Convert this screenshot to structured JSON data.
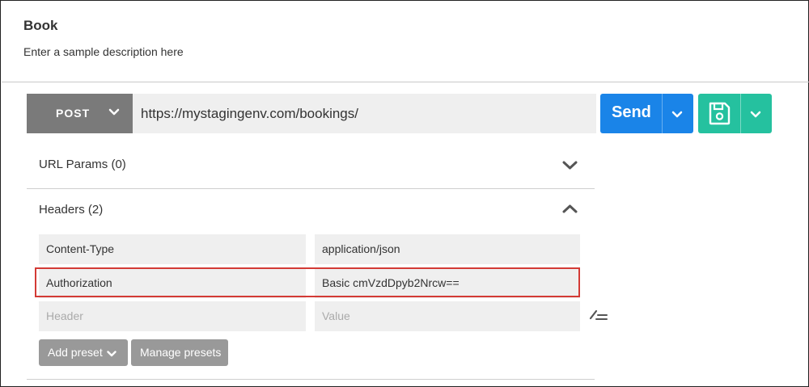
{
  "request": {
    "title": "Book",
    "description": "Enter a sample description here"
  },
  "toolbar": {
    "method": "POST",
    "url": "https://mystagingenv.com/bookings/",
    "send_label": "Send"
  },
  "url_params": {
    "label": "URL Params (0)",
    "expanded": false
  },
  "headers": {
    "label": "Headers (2)",
    "expanded": true,
    "rows": [
      {
        "key": "Content-Type",
        "value": "application/json",
        "highlighted": false
      },
      {
        "key": "Authorization",
        "value": "Basic cmVzdDpyb2Nrcw==",
        "highlighted": true
      }
    ],
    "new_row": {
      "key_placeholder": "Header",
      "value_placeholder": "Value"
    },
    "add_preset_label": "Add preset",
    "manage_presets_label": "Manage presets"
  },
  "colors": {
    "method_bg": "#7a7a7a",
    "send_bg": "#1a84e8",
    "save_bg": "#25c19f",
    "highlight_border": "#d33a35",
    "field_bg": "#efefef",
    "preset_button_bg": "#999999"
  },
  "icons": {
    "method_dropdown": "chevron-down-icon",
    "send_dropdown": "chevron-down-icon",
    "save": "floppy-disk-icon",
    "save_dropdown": "chevron-down-icon",
    "url_params_toggle": "chevron-down-icon",
    "headers_toggle": "chevron-up-icon",
    "bulk_edit": "bulk-edit-icon",
    "add_preset_dropdown": "chevron-down-icon"
  }
}
